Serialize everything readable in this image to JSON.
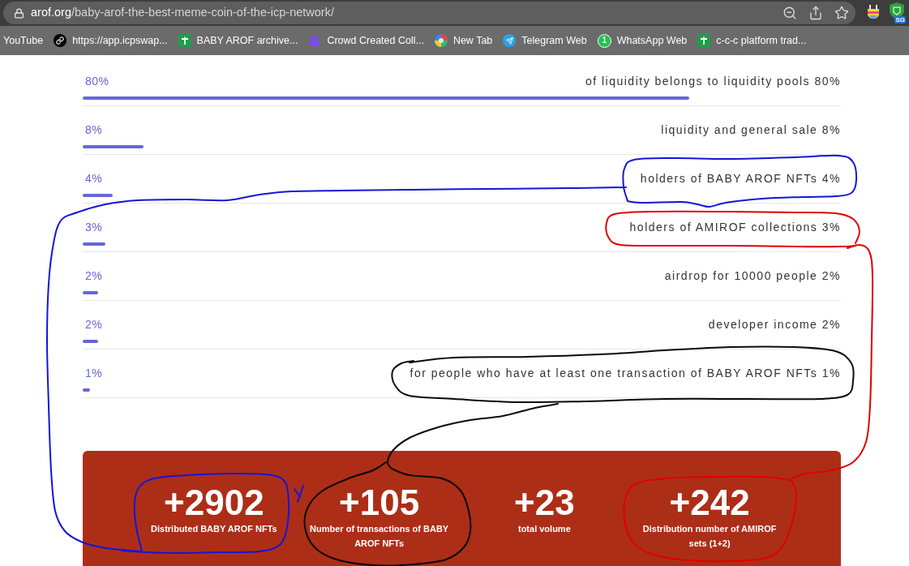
{
  "browser": {
    "url_host": "arof.org",
    "url_path": "/baby-arof-the-best-meme-coin-of-the-icp-network/",
    "extension_badge": "SG"
  },
  "bookmarks": [
    {
      "label": "YouTube"
    },
    {
      "label": "https://app.icpswap...",
      "kind": "link"
    },
    {
      "label": "BABY AROF archive...",
      "kind": "sheet"
    },
    {
      "label": "Crowd Created Coll...",
      "kind": "blob"
    },
    {
      "label": "New Tab",
      "kind": "globe"
    },
    {
      "label": "Telegram Web",
      "kind": "plane"
    },
    {
      "label": "WhatsApp Web",
      "kind": "chat",
      "badge": "1"
    },
    {
      "label": "c-c-c platform trad...",
      "kind": "sheet"
    }
  ],
  "allocations": [
    {
      "percent": "80%",
      "label": "of liquidity belongs to liquidity pools 80%",
      "level": 0.8
    },
    {
      "percent": "8%",
      "label": "liquidity and general sale 8%",
      "level": 0.08
    },
    {
      "percent": "4%",
      "label": "holders of BABY AROF NFTs 4%",
      "level": 0.04
    },
    {
      "percent": "3%",
      "label": "holders of AMIROF collections 3%",
      "level": 0.03
    },
    {
      "percent": "2%",
      "label": "airdrop for 10000 people 2%",
      "level": 0.02
    },
    {
      "percent": "2%",
      "label": "developer income 2%",
      "level": 0.02
    },
    {
      "percent": "1%",
      "label": "for people who have at least one transaction of BABY AROF NFTs 1%",
      "level": 0.01
    }
  ],
  "stats": [
    {
      "value": "+2902",
      "label": "Distributed BABY AROF NFTs"
    },
    {
      "value": "+105",
      "label": "Number of transactions of BABY AROF NFTs"
    },
    {
      "value": "+23",
      "label": "total volume"
    },
    {
      "value": "+242",
      "label": "Distribution number of AMIROF sets (1+2)"
    }
  ],
  "annotations": [
    {
      "color": "#1515d8"
    },
    {
      "color": "#e00000"
    },
    {
      "color": "#0a0a0a"
    }
  ]
}
